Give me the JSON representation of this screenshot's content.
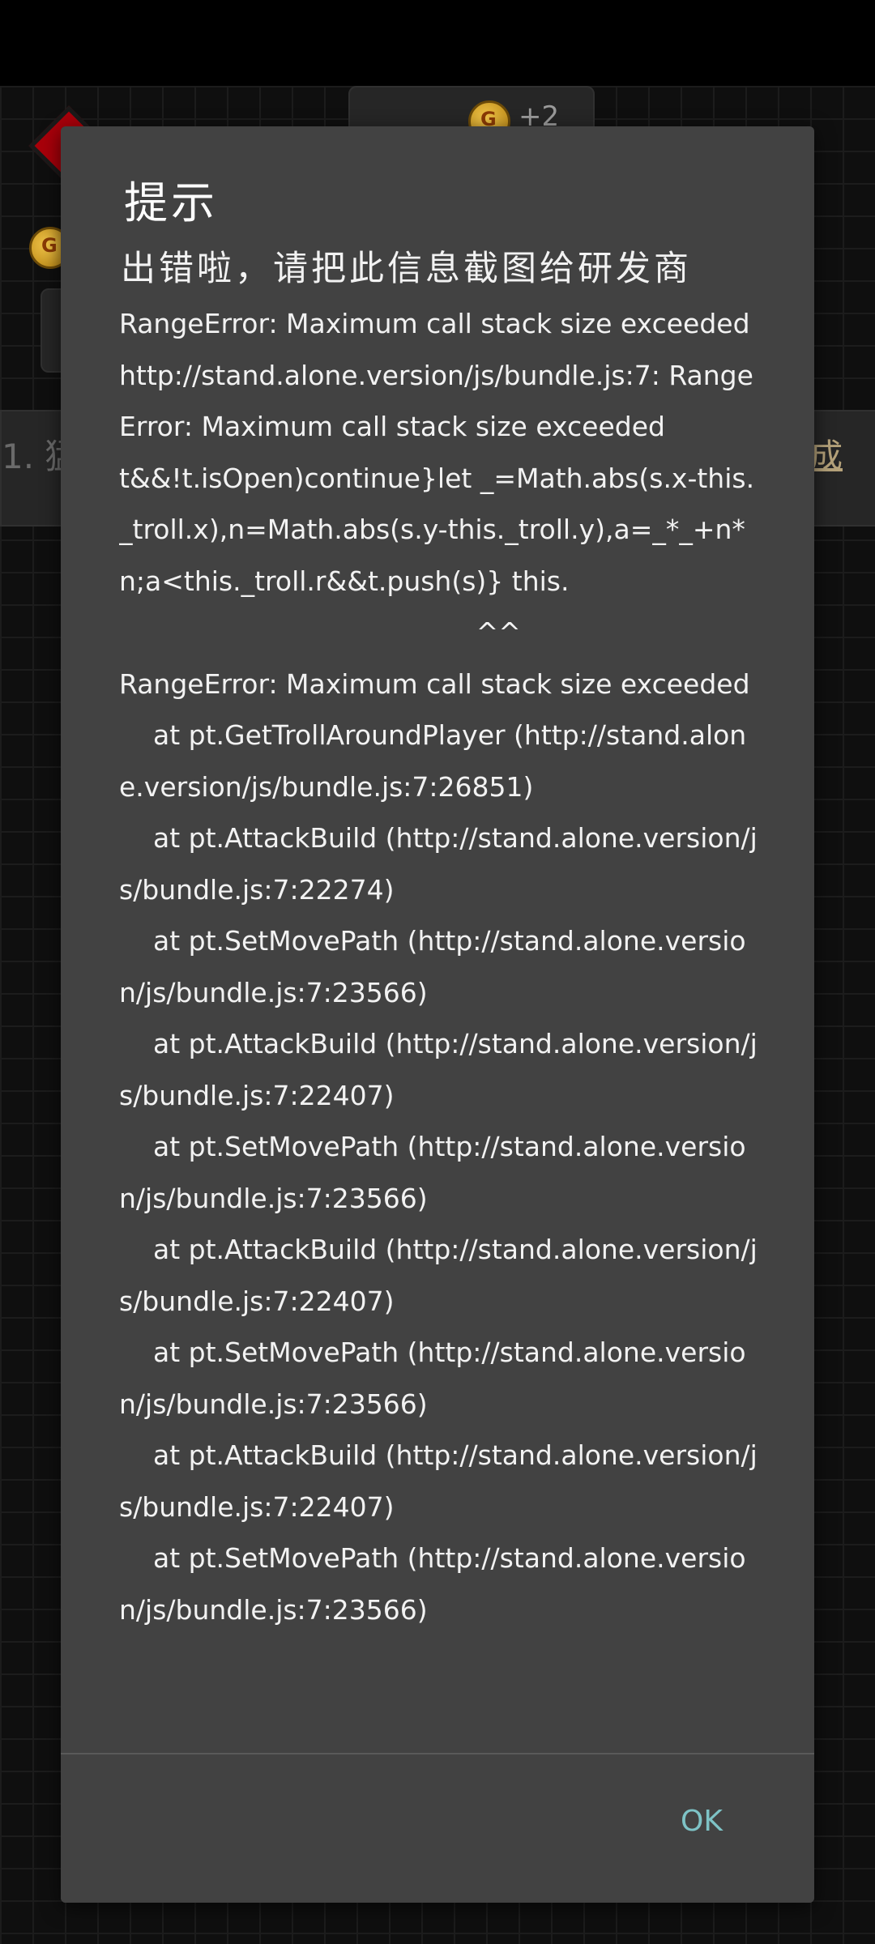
{
  "background": {
    "plus_text": "+2",
    "coin_glyph": "G",
    "quest_number": "1. 猛",
    "quest_link": "成"
  },
  "dialog": {
    "title": "提示",
    "heading": "出错啦，请把此信息截图给研发商",
    "message": "RangeError: Maximum call stack size exceeded\nhttp://stand.alone.version/js/bundle.js:7: RangeError: Maximum call stack size exceeded\nt&&!t.isOpen)continue}let _=Math.abs(s.x-this._troll.x),n=Math.abs(s.y-this._troll.y),a=_*_+n*n;a<this._troll.r&&t.push(s)} this.\n                                          ^^\nRangeError: Maximum call stack size exceeded\n    at pt.GetTrollAroundPlayer (http://stand.alone.version/js/bundle.js:7:26851)\n    at pt.AttackBuild (http://stand.alone.version/js/bundle.js:7:22274)\n    at pt.SetMovePath (http://stand.alone.version/js/bundle.js:7:23566)\n    at pt.AttackBuild (http://stand.alone.version/js/bundle.js:7:22407)\n    at pt.SetMovePath (http://stand.alone.version/js/bundle.js:7:23566)\n    at pt.AttackBuild (http://stand.alone.version/js/bundle.js:7:22407)\n    at pt.SetMovePath (http://stand.alone.version/js/bundle.js:7:23566)\n    at pt.AttackBuild (http://stand.alone.version/js/bundle.js:7:22407)\n    at pt.SetMovePath (http://stand.alone.version/js/bundle.js:7:23566)",
    "ok_label": "OK"
  },
  "colors": {
    "dialog_bg": "#424242",
    "accent_ok": "#7ec3c6",
    "text": "#f2f2f2"
  }
}
